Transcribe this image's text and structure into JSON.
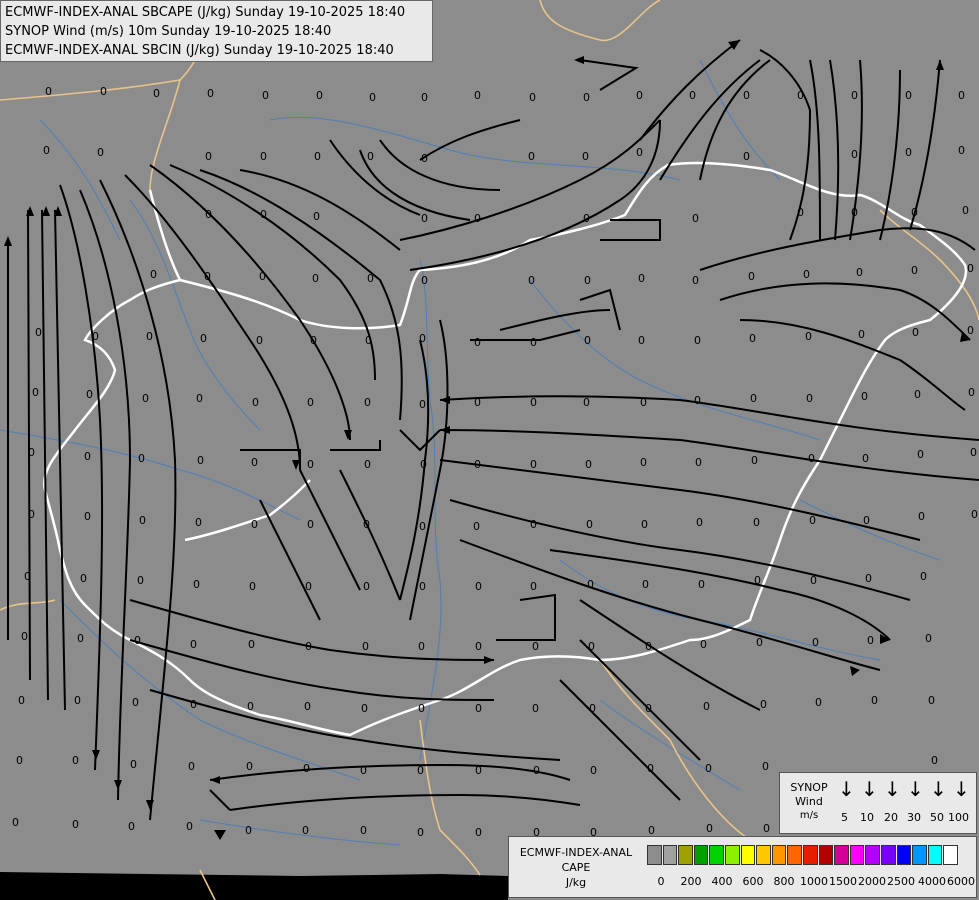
{
  "header": {
    "line1": "ECMWF-INDEX-ANAL SBCAPE (J/kg) Sunday 19-10-2025 18:40",
    "line2": "SYNOP Wind (m/s) 10m Sunday 19-10-2025 18:40",
    "line3": "ECMWF-INDEX-ANAL SBCIN (J/kg) Sunday 19-10-2025 18:40"
  },
  "synop_legend": {
    "title_lines": [
      "SYNOP",
      "Wind",
      "m/s"
    ],
    "speeds": [
      "5",
      "10",
      "20",
      "30",
      "50",
      "100"
    ],
    "arrow_glyph": "↓"
  },
  "cape_legend": {
    "title_lines": [
      "ECMWF-INDEX-ANAL",
      "CAPE",
      "J/kg"
    ],
    "labels": [
      "0",
      "200",
      "400",
      "600",
      "800",
      "1000",
      "1500",
      "2000",
      "2500",
      "4000",
      "6000"
    ],
    "colors": [
      "#8c8c8c",
      "#a0a0a0",
      "#a0a000",
      "#00a000",
      "#00d200",
      "#8cf000",
      "#ffff00",
      "#ffc800",
      "#ff9600",
      "#ff6400",
      "#e61e00",
      "#b40000",
      "#d20096",
      "#ff00ff",
      "#b400ff",
      "#7800ff",
      "#0000ff",
      "#0096ff",
      "#00ffff",
      "#ffffff"
    ]
  },
  "map": {
    "cape_value_label": "0",
    "colors": {
      "background": "#8c8c8c",
      "rivers": "#4f7fb8",
      "borders": "#e8c48a",
      "country_outline": "#ffffff",
      "streamlines": "#000000",
      "sea": "#000000"
    }
  }
}
